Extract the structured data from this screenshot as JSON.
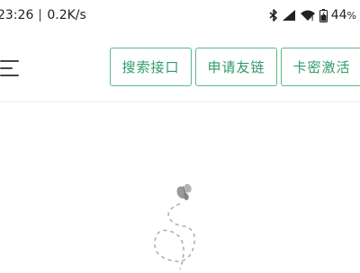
{
  "status_bar": {
    "time": "23:26",
    "network_speed": "0.2K/s",
    "battery_level": "44",
    "battery_unit": "%",
    "icons": [
      "bluetooth-icon",
      "signal-icon",
      "wifi-icon",
      "battery-icon"
    ]
  },
  "header": {
    "menu_icon": "hamburger-menu-icon",
    "buttons": [
      {
        "label": "搜索接口"
      },
      {
        "label": "申请友链"
      },
      {
        "label": "卡密激活"
      }
    ]
  },
  "content": {
    "loading_icon": "butterfly-icon"
  },
  "colors": {
    "accent": "#2e9a6a",
    "button_border": "#5cb88a",
    "divider": "#ececec",
    "loading_gray": "#9a9a9a"
  }
}
